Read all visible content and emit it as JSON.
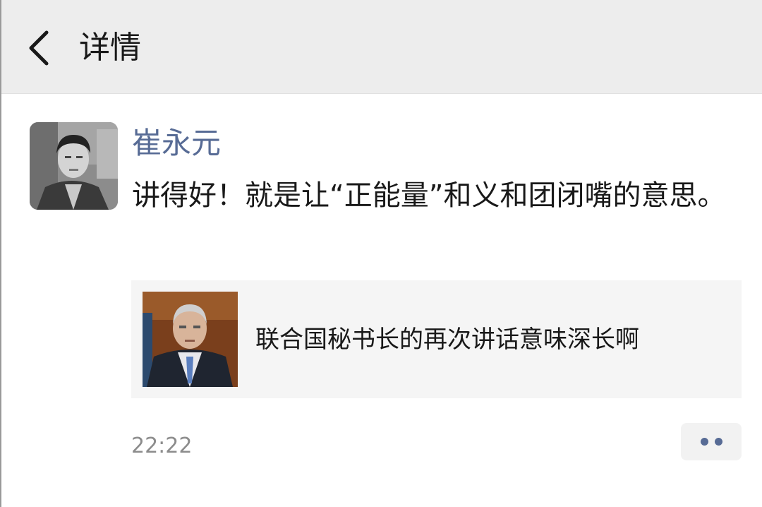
{
  "header": {
    "back_icon": "chevron-left-icon",
    "title": "详情"
  },
  "post": {
    "author": "崔永元",
    "text": "讲得好！就是让“正能量”和义和团闭嘴的意思。",
    "link": {
      "title": "联合国秘书长的再次讲话意味深长啊"
    },
    "timestamp": "22:22",
    "more_icon": "more-dots-icon"
  },
  "colors": {
    "header_bg": "#ededed",
    "name_blue": "#576b95",
    "text": "#191919",
    "meta_gray": "#8c8c8c",
    "card_bg": "#f5f5f5"
  }
}
